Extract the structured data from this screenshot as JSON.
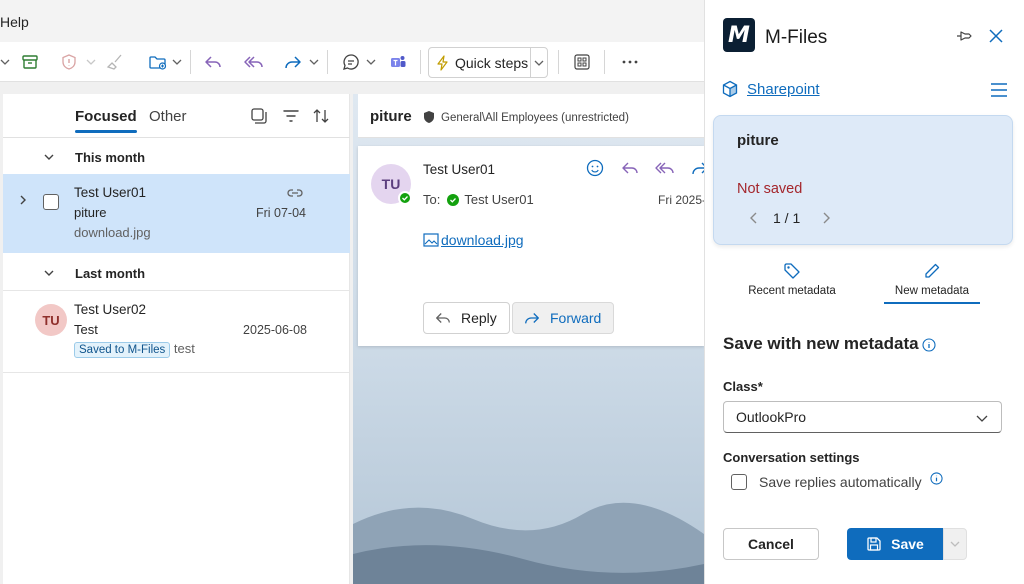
{
  "menu": {
    "help": "Help"
  },
  "toolbar": {
    "quick_steps": "Quick steps"
  },
  "list": {
    "tabs": {
      "focused": "Focused",
      "other": "Other"
    },
    "groups": {
      "this_month": "This month",
      "last_month": "Last month"
    },
    "items": [
      {
        "sender": "Test User01",
        "subject": "piture",
        "preview": "download.jpg",
        "date": "Fri 07-04"
      },
      {
        "initials": "TU",
        "sender": "Test User02",
        "subject": "Test",
        "badge": "Saved to M-Files",
        "preview": "test",
        "date": "2025-06-08"
      }
    ]
  },
  "reading": {
    "subject": "piture",
    "sensitivity": "General\\All Employees (unrestricted)",
    "initials": "TU",
    "sender": "Test User01",
    "to_label": "To:",
    "to_name": "Test User01",
    "date": "Fri 2025-",
    "attachment": "download.jpg",
    "reply": "Reply",
    "forward": "Forward"
  },
  "mfiles": {
    "logo_letter": "M",
    "title": "M-Files",
    "vault": "Sharepoint",
    "card": {
      "name": "piture",
      "status": "Not saved",
      "page": "1 / 1"
    },
    "tabs": {
      "recent": "Recent metadata",
      "new": "New metadata"
    },
    "heading": "Save with new metadata",
    "class_label": "Class*",
    "class_value": "OutlookPro",
    "conv_label": "Conversation settings",
    "save_replies": "Save replies automatically",
    "cancel": "Cancel",
    "save": "Save"
  },
  "colors": {
    "accent": "#0f6cbd",
    "selected_row": "#cfe4fa",
    "not_saved": "#a4262c",
    "presence": "#13a10e",
    "card_bg": "#deeaf8"
  }
}
